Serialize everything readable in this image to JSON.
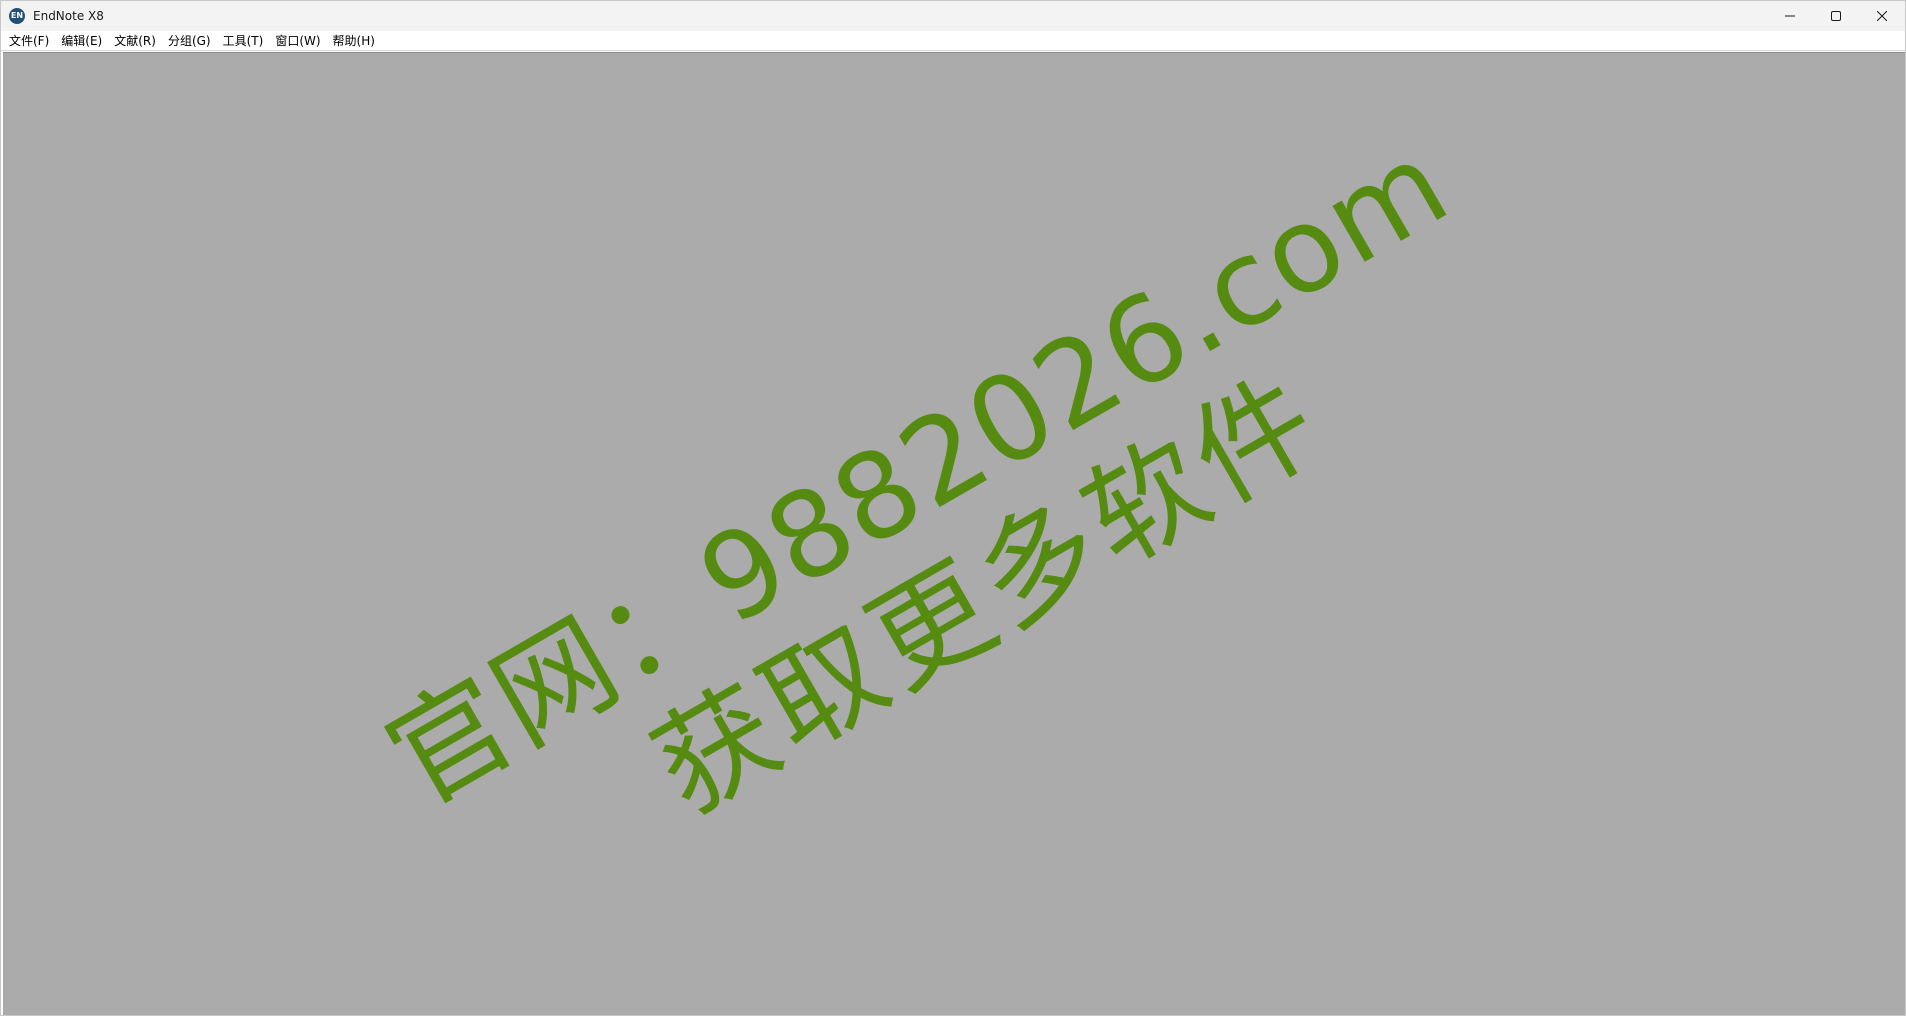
{
  "window": {
    "title": "EndNote X8",
    "icon": "endnote-app-icon",
    "icon_text": "EN"
  },
  "controls": {
    "minimize_icon": "minimize-icon",
    "maximize_icon": "maximize-icon",
    "close_icon": "close-icon"
  },
  "menu": {
    "items": [
      {
        "label": "文件(F)"
      },
      {
        "label": "编辑(E)"
      },
      {
        "label": "文献(R)"
      },
      {
        "label": "分组(G)"
      },
      {
        "label": "工具(T)"
      },
      {
        "label": "窗口(W)"
      },
      {
        "label": "帮助(H)"
      }
    ]
  },
  "workspace": {
    "background_color": "#ababab",
    "watermark": {
      "line1": "官网：9882026.com",
      "line2": "获取更多软件",
      "color": "#568b12"
    }
  }
}
